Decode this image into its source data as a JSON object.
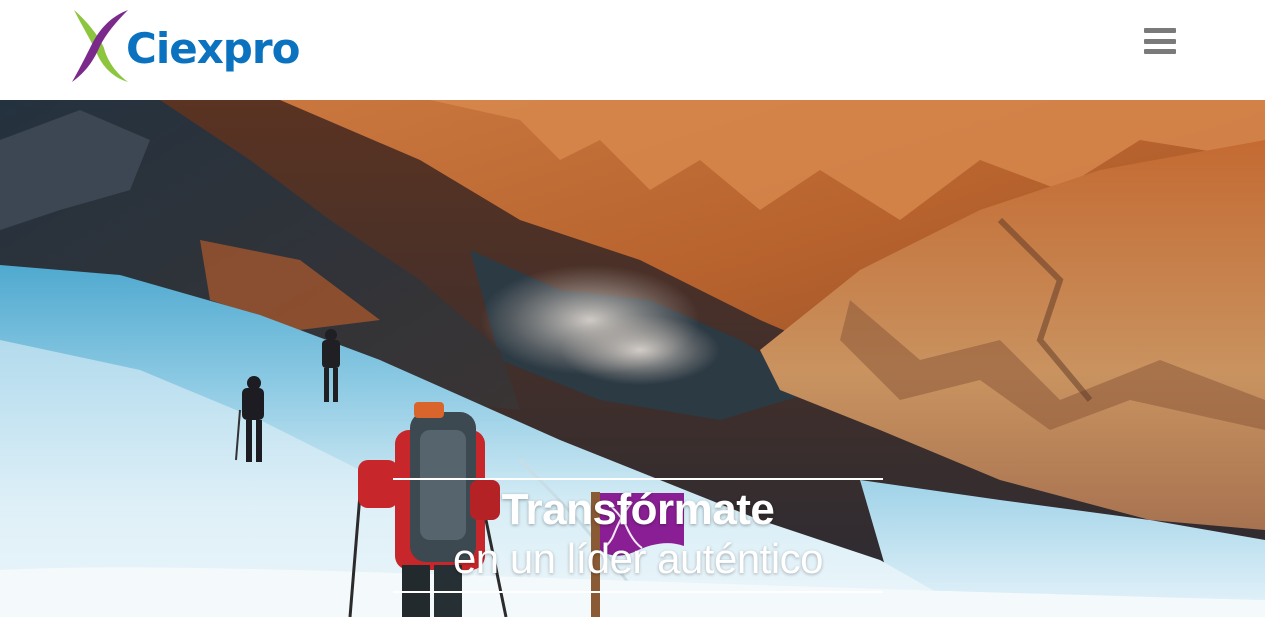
{
  "header": {
    "logo": {
      "text": "Ciexpro",
      "text_color": "#0a72bf",
      "mark_colors": {
        "green": "#8cc63f",
        "purple": "#7b2a8c"
      }
    },
    "menu": {
      "icon": "hamburger-menu-icon",
      "color": "#7a7a7a"
    }
  },
  "hero": {
    "title": "Transfórmate",
    "subtitle": "en un líder auténtico",
    "flag": {
      "icon": "ciexpro-x-mark",
      "color": "#8a1f95"
    }
  }
}
